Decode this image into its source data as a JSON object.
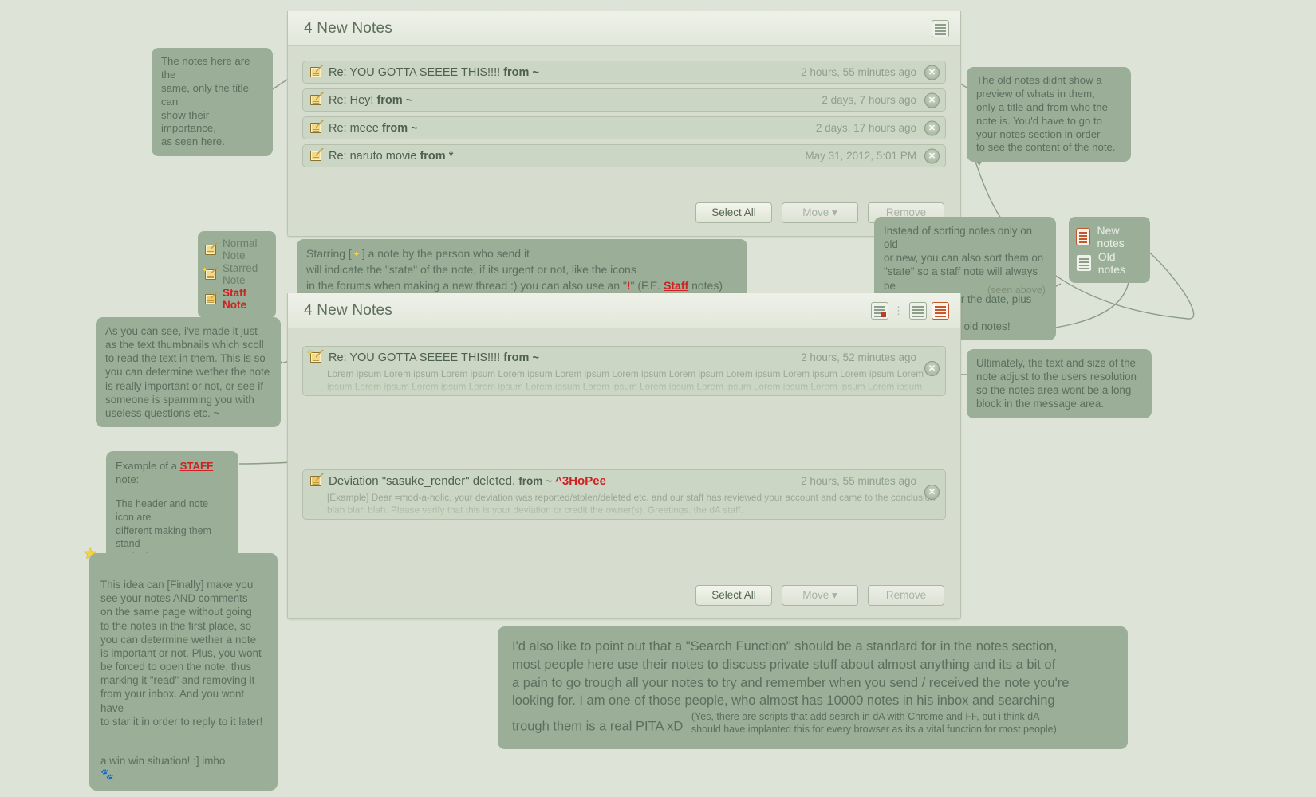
{
  "panel_new": {
    "title": "4 New Notes",
    "header_icon": "list-sort-icon",
    "notes": [
      {
        "icon": "normal-note-icon",
        "title": "Re: YOU GOTTA SEEEE THIS!!!!",
        "from": "from ~",
        "time": "2 hours, 55 minutes ago"
      },
      {
        "icon": "normal-note-icon",
        "title": "Re: Hey!",
        "from": "from ~",
        "time": "2 days, 7 hours ago"
      },
      {
        "icon": "normal-note-icon",
        "title": "Re: meee",
        "from": "from ~",
        "time": "2 days, 17 hours ago"
      },
      {
        "icon": "normal-note-icon",
        "title": "Re: naruto movie",
        "from": "from *",
        "time": "May 31, 2012, 5:01 PM"
      }
    ],
    "buttons": {
      "select_all": "Select All",
      "move": "Move ▾",
      "remove": "Remove"
    }
  },
  "panel_preview": {
    "title": "4 New Notes",
    "toolbar": {
      "sort_state_icon": "sort-by-state-icon",
      "new_notes_icon": "new-notes-icon",
      "old_notes_icon": "old-notes-icon",
      "separator": "⋮"
    },
    "notes": [
      {
        "icon": "starred-note-icon",
        "title": "Re: YOU GOTTA SEEEE THIS!!!!",
        "from": "from ~",
        "time": "2 hours, 52 minutes ago",
        "preview": "Lorem ipsum Lorem ipsum Lorem ipsum Lorem ipsum Lorem ipsum Lorem ipsum Lorem ipsum Lorem ipsum Lorem ipsum Lorem ipsum Lorem ipsum Lorem ipsum Lorem ipsum Lorem ipsum Lorem ipsum Lorem ipsum Lorem ipsum Lorem ipsum Lorem ipsum Lorem ipsum Lorem ipsum"
      },
      {
        "icon": "staff-note-icon",
        "title": "Deviation \"sasuke_render\" deleted.",
        "from": "from ~",
        "from_user": "^3HoPee",
        "time": "2 hours, 55 minutes ago",
        "preview": "[Example] Dear =mod-a-holic, your deviation was reported/stolen/deleted etc. and our staff has reviewed your account and came to the conclusion blah blah blah. Please verify that this is your deviation or credit the owner(s). Greetings, the dA staff."
      }
    ],
    "buttons": {
      "select_all": "Select All",
      "move": "Move ▾",
      "remove": "Remove"
    }
  },
  "legend_notes": {
    "items": [
      {
        "icon": "normal-note-icon",
        "label": "Normal Note"
      },
      {
        "icon": "starred-note-icon",
        "label": "Starred Note"
      },
      {
        "icon": "staff-note-icon",
        "label": "Staff Note"
      }
    ]
  },
  "legend_sort": {
    "items": [
      {
        "icon": "new-notes-icon",
        "label": "New notes"
      },
      {
        "icon": "old-notes-icon",
        "label": "Old notes"
      }
    ]
  },
  "callouts": {
    "same_notes": "The notes here are the\nsame, only the title can\nshow their importance,\nas seen here.",
    "old_notes_a": "The old notes didnt show a\npreview of whats in them,\nonly a title and from who the\nnote is. You'd have to go to",
    "old_notes_link": "notes section",
    "old_notes_b": "your ",
    "old_notes_c": " in order\nto see the content of the note.",
    "starring_l1_a": "Starring [",
    "starring_l1_b": "] a note by the person who send it",
    "starring_l2": "will indicate the \"state\" of the note, if its urgent or not, like the icons",
    "starring_l3_a": "in the forums when making  a new thread :) you can also use an \"",
    "starring_l3_bang": "!",
    "starring_l3_b": "\"  (F.E. ",
    "starring_l3_staff": "Staff",
    "starring_l3_c": " notes)",
    "sorting": "Instead of sorting notes only on old\nor new, you can also sort them on\n\"state\" so a staff note will always be\non top, no matter the date, plus you\ncan revert to the old notes!",
    "seen_above": "(seen above)",
    "thumbnails": "As you can see, i've made it just\nas the text thumbnails which scoll\nto read the text in them. This is so\nyou can determine wether the note\nis really important or not, or see if\nsomeone is spamming you with\nuseless questions etc. ~",
    "resolution": "Ultimately, the text and size of the\nnote adjust to the users resolution\nso the notes area wont be a long\nblock in the message area.",
    "staff_example_a": "Example of a ",
    "staff_example_link": "STAFF",
    "staff_example_b": " note:",
    "staff_example_c": "The header and note icon are\ndifferent making them stand\nout in the message center.",
    "finally": "This idea can [Finally] make you\nsee your notes AND comments\non the same page without going\nto the notes in the first place, so\nyou can determine wether a note\nis important or not. Plus, you wont\nbe forced to open the note, thus\nmarking it \"read\" and removing it\nfrom your inbox. And you wont have\nto star it in order to reply to it later!",
    "win_win": "a win win situation! :] imho",
    "search_main": "I'd also like to point out that a \"Search Function\" should be a standard for in the notes section,\nmost people here use their notes to discuss private stuff about almost anything and its a bit of\na pain to go trough all your notes to try and remember when you send / received the note you're\nlooking for. I am one of those people, who almost has 10000 notes in his inbox and searching\ntrough them is a real PITA xD",
    "search_fine": "(Yes, there are scripts that add search in dA with Chrome and FF, but i think dA\nshould have implanted this for every browser as its a vital function for most people)"
  },
  "colors": {
    "bg": "#dde3d6",
    "bubble": "#9bae97",
    "panel": "#d6ddce",
    "accent_red": "#cc2222",
    "note_icon": "#f2d98b"
  }
}
